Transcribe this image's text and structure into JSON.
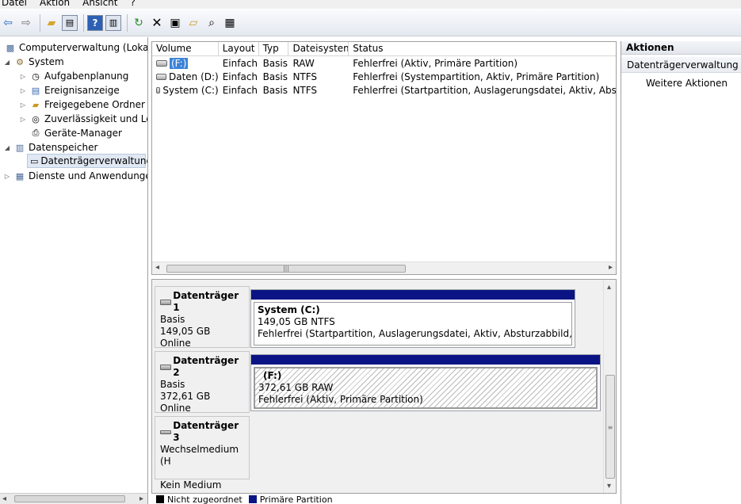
{
  "menubar": {
    "items": [
      "Datei",
      "Aktion",
      "Ansicht",
      "?"
    ]
  },
  "tree": {
    "root": "Computerverwaltung (Lokal)",
    "system": "System",
    "aufgabenplanung": "Aufgabenplanung",
    "ereignisanzeige": "Ereignisanzeige",
    "freigegebene_ordner": "Freigegebene Ordner",
    "zuverlaessigkeit": "Zuverlässigkeit und Leis",
    "geraete_manager": "Geräte-Manager",
    "datenspeicher": "Datenspeicher",
    "datentraegerverwaltung": "Datenträgerverwaltung",
    "dienste": "Dienste und Anwendungen"
  },
  "volumes": {
    "headers": [
      "Volume",
      "Layout",
      "Typ",
      "Dateisystem",
      "Status"
    ],
    "rows": [
      {
        "volume": "(F:)",
        "layout": "Einfach",
        "typ": "Basis",
        "fs": "RAW",
        "status": "Fehlerfrei (Aktiv, Primäre Partition)"
      },
      {
        "volume": "Daten (D:)",
        "layout": "Einfach",
        "typ": "Basis",
        "fs": "NTFS",
        "status": "Fehlerfrei (Systempartition, Aktiv, Primäre Partition)"
      },
      {
        "volume": "System (C:)",
        "layout": "Einfach",
        "typ": "Basis",
        "fs": "NTFS",
        "status": "Fehlerfrei (Startpartition, Auslagerungsdatei, Aktiv, Absturzabbild, Primäre"
      }
    ]
  },
  "disks": [
    {
      "title": "Datenträger 1",
      "kind": "Basis",
      "size": "149,05 GB",
      "state": "Online",
      "partition": {
        "name": "System  (C:)",
        "size_fs": "149,05 GB NTFS",
        "status": "Fehlerfrei (Startpartition, Auslagerungsdatei, Aktiv, Absturzabbild, Primäre P"
      }
    },
    {
      "title": "Datenträger 2",
      "kind": "Basis",
      "size": "372,61 GB",
      "state": "Online",
      "partition": {
        "name": "(F:)",
        "size_fs": "372,61 GB RAW",
        "status": "Fehlerfrei (Aktiv, Primäre Partition)"
      }
    },
    {
      "title": "Datenträger 3",
      "kind": "Wechselmedium (H",
      "size": "",
      "state": "Kein Medium"
    }
  ],
  "legend": {
    "unallocated": "Nicht zugeordnet",
    "primary": "Primäre Partition",
    "unallocated_color": "#000000",
    "primary_color": "#0a1484"
  },
  "actions": {
    "header": "Aktionen",
    "section": "Datenträgerverwaltung",
    "more": "Weitere Aktionen"
  },
  "toolbar_icons": [
    "back-arrow-icon",
    "forward-arrow-icon",
    "up-folder-icon",
    "show-hide-tree-icon",
    "help-icon",
    "show-hide-action-pane-icon",
    "refresh-icon",
    "delete-icon",
    "properties-icon",
    "open-folder-icon",
    "search-icon",
    "export-list-icon"
  ]
}
